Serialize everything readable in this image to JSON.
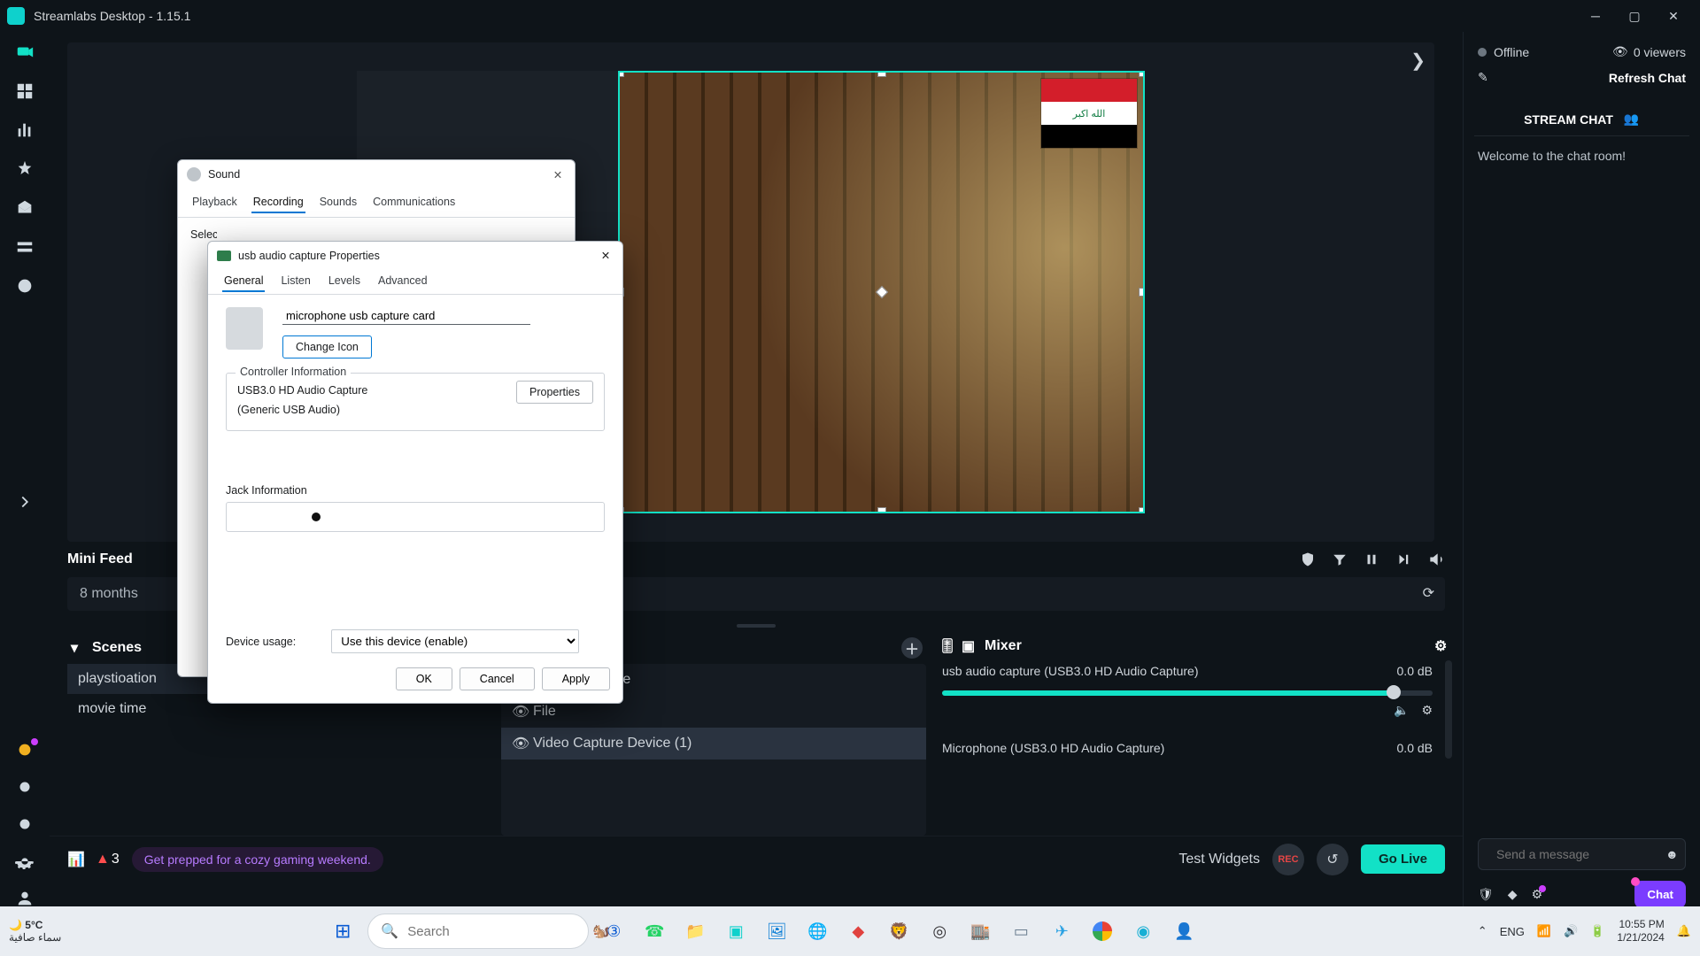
{
  "window": {
    "title": "Streamlabs Desktop - 1.15.1"
  },
  "status": {
    "offline": "Offline",
    "viewers": "0 viewers",
    "refreshChat": "Refresh Chat"
  },
  "chat": {
    "header": "STREAM CHAT",
    "welcome": "Welcome to the chat room!",
    "placeholder": "Send a message",
    "chatBtn": "Chat"
  },
  "minifeed": {
    "title": "Mini Feed",
    "item": "8 months"
  },
  "panels": {
    "scenes": {
      "title": "Scenes",
      "items": [
        "playstioation",
        "movie time"
      ]
    },
    "sources": {
      "items": [
        "Capture Device",
        "File",
        "Video Capture Device (1)"
      ]
    },
    "mixer": {
      "title": "Mixer",
      "tracks": [
        {
          "name": "usb audio capture (USB3.0 HD Audio Capture)",
          "db": "0.0 dB",
          "fill": 92
        },
        {
          "name": "Microphone (USB3.0 HD Audio Capture)",
          "db": "0.0 dB",
          "fill": 0
        }
      ]
    }
  },
  "footer": {
    "tip": "Get prepped for a cozy gaming weekend.",
    "test": "Test Widgets",
    "golive": "Go Live",
    "warn": "3"
  },
  "soundDialog": {
    "title": "Sound",
    "tabs": [
      "Playback",
      "Recording",
      "Sounds",
      "Communications"
    ],
    "activeTab": 1,
    "hint": "Select a recording device below to modify its settings:"
  },
  "propsDialog": {
    "title": "usb audio capture  Properties",
    "tabs": [
      "General",
      "Listen",
      "Levels",
      "Advanced"
    ],
    "activeTab": 0,
    "deviceName": "microphone usb capture card",
    "changeIcon": "Change Icon",
    "controller": {
      "legend": "Controller Information",
      "line1": "USB3.0 HD Audio Capture",
      "line2": "(Generic USB Audio)",
      "propsBtn": "Properties"
    },
    "jackLegend": "Jack Information",
    "usageLabel": "Device usage:",
    "usageValue": "Use this device (enable)",
    "buttons": {
      "ok": "OK",
      "cancel": "Cancel",
      "apply": "Apply"
    }
  },
  "taskbar": {
    "temp": "5°C",
    "weather": "سماء صافية",
    "search": "Search",
    "lang": "ENG",
    "time": "10:55 PM",
    "date": "1/21/2024"
  }
}
